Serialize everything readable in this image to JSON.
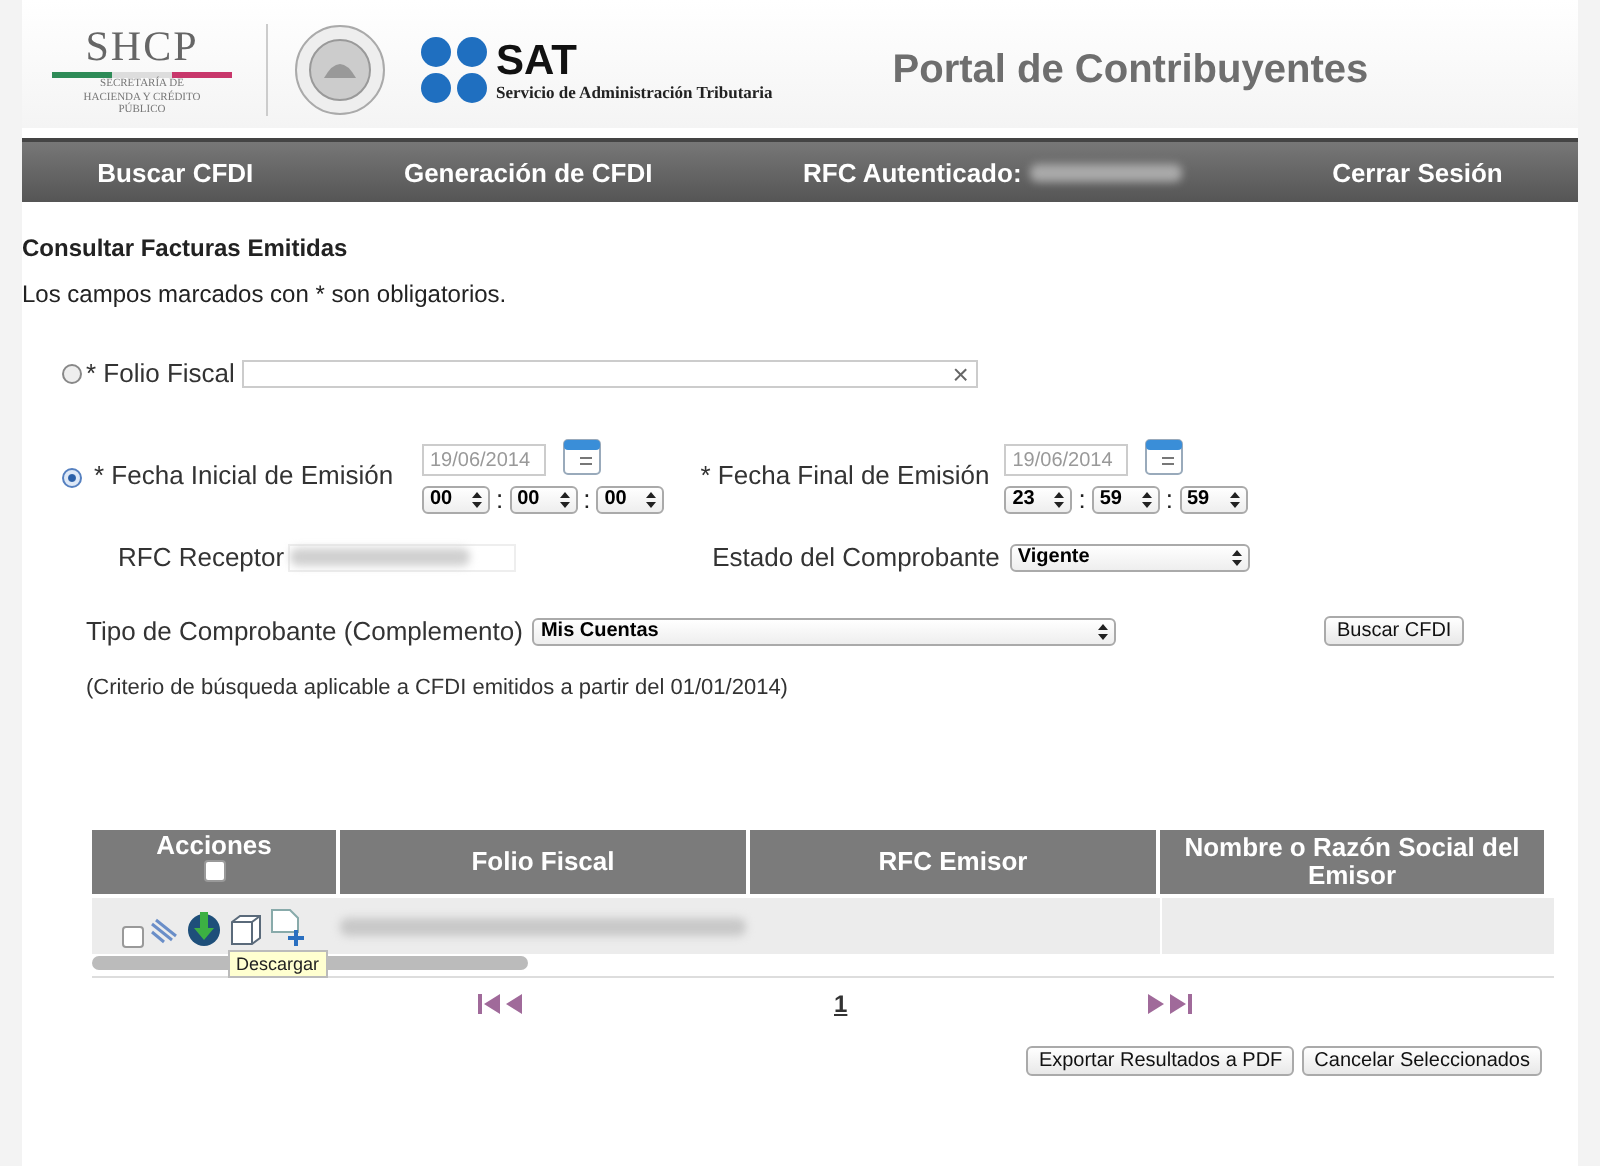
{
  "header": {
    "shcp": {
      "name": "SHCP",
      "subtitle": "SECRETARÍA DE HACIENDA Y CRÉDITO PÚBLICO"
    },
    "sat": {
      "name": "SAT",
      "subtitle": "Servicio de Administración Tributaria"
    },
    "title": "Portal de Contribuyentes"
  },
  "nav": [
    {
      "label": "Buscar CFDI",
      "kind": "link"
    },
    {
      "label": "Generación de CFDI",
      "kind": "link"
    },
    {
      "label": "RFC Autenticado:",
      "kind": "rfc"
    },
    {
      "label": "Cerrar Sesión",
      "kind": "link"
    }
  ],
  "heading": "Consultar Facturas Emitidas",
  "note": "Los campos marcados con * son obligatorios.",
  "folio": {
    "label": "* Folio Fiscal",
    "selected": false,
    "clear": "×"
  },
  "dates": {
    "selected": true,
    "start": {
      "label": "* Fecha Inicial de Emisión",
      "date": "19/06/2014",
      "time": [
        "00",
        "00",
        "00"
      ]
    },
    "end": {
      "label": "* Fecha Final de Emisión",
      "date": "19/06/2014",
      "time": [
        "23",
        "59",
        "59"
      ]
    },
    "separator": ":"
  },
  "rfc_receptor": {
    "label": "RFC Receptor"
  },
  "estado": {
    "label": "Estado del Comprobante",
    "value": "Vigente"
  },
  "tipo": {
    "label": "Tipo de Comprobante (Complemento)",
    "value": "Mis Cuentas"
  },
  "search_button": "Buscar CFDI",
  "criteria": "(Criterio de búsqueda aplicable a CFDI emitidos a partir del 01/01/2014)",
  "table": {
    "columns": [
      "Acciones",
      "Folio Fiscal",
      "RFC Emisor",
      "Nombre o Razón Social del Emisor"
    ],
    "header_checked": false,
    "rows": [
      {
        "checked": false
      }
    ]
  },
  "tooltip": "Descargar",
  "pager": {
    "page": "1"
  },
  "buttons": [
    "Exportar Resultados a PDF",
    "Cancelar Seleccionados"
  ]
}
